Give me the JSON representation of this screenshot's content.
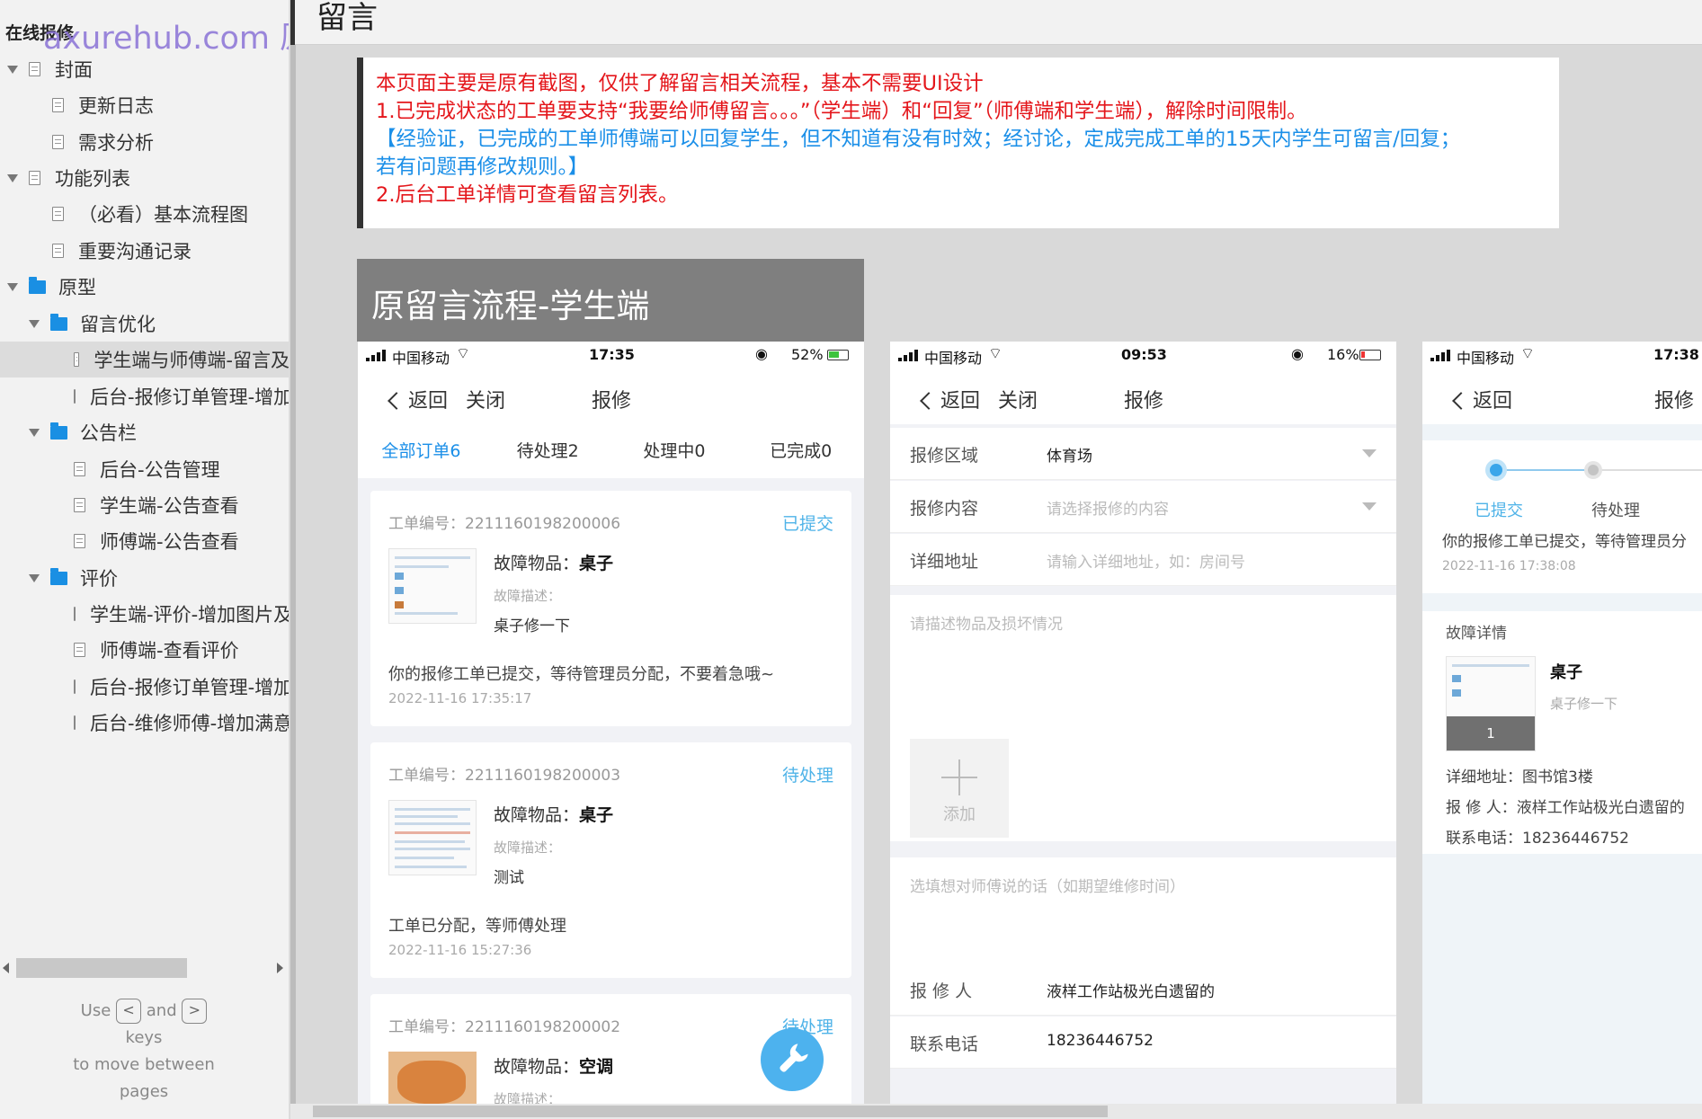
{
  "sidebar": {
    "project_title": "在线报修",
    "watermark": "axurehub.com 原型资源站",
    "items": [
      {
        "label": "封面"
      },
      {
        "label": "更新日志"
      },
      {
        "label": "需求分析"
      },
      {
        "label": "功能列表"
      },
      {
        "label": "（必看）基本流程图"
      },
      {
        "label": "重要沟通记录"
      },
      {
        "label": "原型"
      },
      {
        "label": "留言优化"
      },
      {
        "label": "学生端与师傅端-留言及"
      },
      {
        "label": "后台-报修订单管理-增加"
      },
      {
        "label": "公告栏"
      },
      {
        "label": "后台-公告管理"
      },
      {
        "label": "学生端-公告查看"
      },
      {
        "label": "师傅端-公告查看"
      },
      {
        "label": "评价"
      },
      {
        "label": "学生端-评价-增加图片及"
      },
      {
        "label": "师傅端-查看评价"
      },
      {
        "label": "后台-报修订单管理-增加"
      },
      {
        "label": "后台-维修师傅-增加满意"
      }
    ],
    "hint": {
      "use": "Use",
      "key_prev": "<",
      "and": "and",
      "key_next": ">",
      "keys": "keys",
      "to_move": "to move between",
      "pages": "pages"
    }
  },
  "page": {
    "heading": "留言"
  },
  "note": {
    "line1": "本页面主要是原有截图，仅供了解留言相关流程，基本不需要UI设计",
    "line2": "1.已完成状态的工单要支持“我要给师傅留言。。。”（学生端）和“回复”（师傅端和学生端），解除时间限制。",
    "line3": "【经验证，已完成的工单师傅端可以回复学生，但不知道有没有时效；经讨论，定成完成工单的15天内学生可留言/回复；",
    "line4": "若有问题再修改规则。】",
    "line5": "2.后台工单详情可查看留言列表。"
  },
  "panel_title": "原留言流程-学生端",
  "phone1": {
    "status": {
      "carrier": "中国移动",
      "time": "17:35",
      "battery": "52%"
    },
    "nav": {
      "back": "返回",
      "close": "关闭",
      "title": "报修"
    },
    "tabs": [
      "全部订单6",
      "待处理2",
      "处理中0",
      "已完成0"
    ],
    "orders": [
      {
        "no_label": "工单编号：2211160198200006",
        "status": "已提交",
        "item_label": "故障物品：",
        "item": "桌子",
        "desc_label": "故障描述：",
        "desc": "桌子修一下",
        "msg": "你的报修工单已提交，等待管理员分配，不要着急哦~",
        "time": "2022-11-16 17:35:17"
      },
      {
        "no_label": "工单编号：2211160198200003",
        "status": "待处理",
        "item_label": "故障物品：",
        "item": "桌子",
        "desc_label": "故障描述：",
        "desc": "测试",
        "msg": "工单已分配，等师傅处理",
        "time": "2022-11-16 15:27:36"
      },
      {
        "no_label": "工单编号：2211160198200002",
        "status": "待处理",
        "item_label": "故障物品：",
        "item": "空调",
        "desc_label": "故障描述："
      }
    ],
    "fab_icon": "wrench-icon"
  },
  "phone2": {
    "status": {
      "carrier": "中国移动",
      "time": "09:53",
      "battery": "16%"
    },
    "nav": {
      "back": "返回",
      "close": "关闭",
      "title": "报修"
    },
    "area_label": "报修区域",
    "area_value": "体育场",
    "content_label": "报修内容",
    "content_placeholder": "请选择报修的内容",
    "address_label": "详细地址",
    "address_placeholder": "请输入详细地址，如：房间号",
    "describe_placeholder": "请描述物品及损坏情况",
    "add_label": "添加",
    "message_placeholder": "选填想对师傅说的话（如期望维修时间）",
    "reporter_label": "报 修 人",
    "reporter_value": "液样工作站极光白遗留的",
    "phone_label": "联系电话",
    "phone_value": "18236446752"
  },
  "phone3": {
    "status": {
      "carrier": "中国移动",
      "time": "17:38"
    },
    "nav": {
      "back": "返回",
      "title": "报修"
    },
    "steps": [
      "已提交",
      "待处理"
    ],
    "progress_msg": "你的报修工单已提交，等待管理员分",
    "progress_time": "2022-11-16 17:38:08",
    "detail_title": "故障详情",
    "item": "桌子",
    "desc": "桌子修一下",
    "img_count": "1",
    "address": "详细地址：图书馆3楼",
    "reporter": "报 修 人：液样工作站极光白遗留的",
    "contact": "联系电话：18236446752"
  },
  "colors": {
    "accent_blue": "#1b8fe8",
    "note_red": "#e4161b",
    "status_blue": "#4fb3e8"
  }
}
